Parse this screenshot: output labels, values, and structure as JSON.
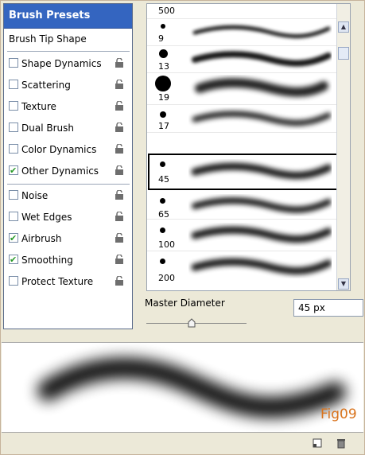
{
  "panel": {
    "header": "Brush Presets",
    "options": [
      {
        "label": "Brush Tip Shape",
        "checkbox": false,
        "checked": false,
        "lock": false
      },
      {
        "label": "Shape Dynamics",
        "checkbox": true,
        "checked": false,
        "lock": true
      },
      {
        "label": "Scattering",
        "checkbox": true,
        "checked": false,
        "lock": true
      },
      {
        "label": "Texture",
        "checkbox": true,
        "checked": false,
        "lock": true
      },
      {
        "label": "Dual Brush",
        "checkbox": true,
        "checked": false,
        "lock": true
      },
      {
        "label": "Color Dynamics",
        "checkbox": true,
        "checked": false,
        "lock": true
      },
      {
        "label": "Other Dynamics",
        "checkbox": true,
        "checked": true,
        "lock": true
      },
      {
        "label": "Noise",
        "checkbox": true,
        "checked": false,
        "lock": true
      },
      {
        "label": "Wet Edges",
        "checkbox": true,
        "checked": false,
        "lock": true
      },
      {
        "label": "Airbrush",
        "checkbox": true,
        "checked": true,
        "lock": true
      },
      {
        "label": "Smoothing",
        "checkbox": true,
        "checked": true,
        "lock": true
      },
      {
        "label": "Protect Texture",
        "checkbox": true,
        "checked": false,
        "lock": true
      }
    ]
  },
  "brushes": [
    {
      "size": "500"
    },
    {
      "size": "9"
    },
    {
      "size": "13"
    },
    {
      "size": "19"
    },
    {
      "size": "17"
    },
    {
      "size": "45",
      "selected": true
    },
    {
      "size": "65"
    },
    {
      "size": "100"
    },
    {
      "size": "200"
    }
  ],
  "master": {
    "label": "Master Diameter",
    "value": "45 px",
    "fraction": 0.42
  },
  "figure_label": "Fig09",
  "colors": {
    "header": "#3465c0",
    "accent": "#d9731c"
  }
}
